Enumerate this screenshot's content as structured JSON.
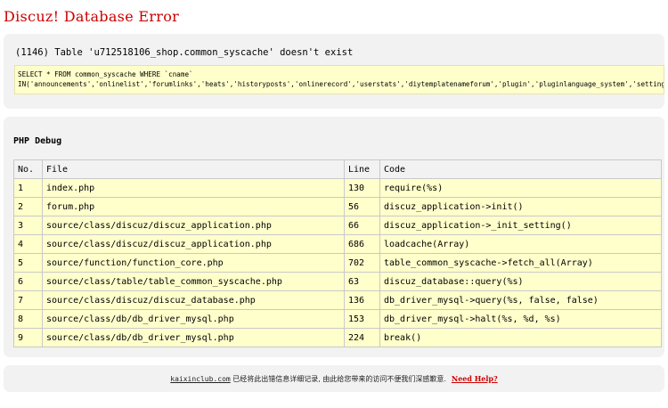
{
  "title": "Discuz! Database Error",
  "error": {
    "message": "(1146) Table 'u712518106_shop.common_syscache' doesn't exist",
    "sql_line1": "SELECT * FROM common_syscache WHERE `cname` ",
    "sql_line2": "IN('announcements','onlinelist','forumlinks','heats','historyposts','onlinerecord','userstats','diytemplatenameforum','plugin','pluginlanguage_system','setting','style_default','cronnextrun')"
  },
  "debug": {
    "title": "PHP Debug",
    "columns": [
      "No.",
      "File",
      "Line",
      "Code"
    ],
    "rows": [
      {
        "no": "1",
        "file": "index.php",
        "line": "130",
        "code": "require(%s)"
      },
      {
        "no": "2",
        "file": "forum.php",
        "line": "56",
        "code": "discuz_application->init()"
      },
      {
        "no": "3",
        "file": "source/class/discuz/discuz_application.php",
        "line": "66",
        "code": "discuz_application->_init_setting()"
      },
      {
        "no": "4",
        "file": "source/class/discuz/discuz_application.php",
        "line": "686",
        "code": "loadcache(Array)"
      },
      {
        "no": "5",
        "file": "source/function/function_core.php",
        "line": "702",
        "code": "table_common_syscache->fetch_all(Array)"
      },
      {
        "no": "6",
        "file": "source/class/table/table_common_syscache.php",
        "line": "63",
        "code": "discuz_database::query(%s)"
      },
      {
        "no": "7",
        "file": "source/class/discuz/discuz_database.php",
        "line": "136",
        "code": "db_driver_mysql->query(%s, false, false)"
      },
      {
        "no": "8",
        "file": "source/class/db/db_driver_mysql.php",
        "line": "153",
        "code": "db_driver_mysql->halt(%s, %d, %s)"
      },
      {
        "no": "9",
        "file": "source/class/db/db_driver_mysql.php",
        "line": "224",
        "code": "break()"
      }
    ]
  },
  "footer": {
    "site_link": "kaixinclub.com",
    "notice": " 已经将此出错信息详细记录, 由此给您带来的访问不便我们深感歉意.",
    "help_link": "Need Help?"
  }
}
